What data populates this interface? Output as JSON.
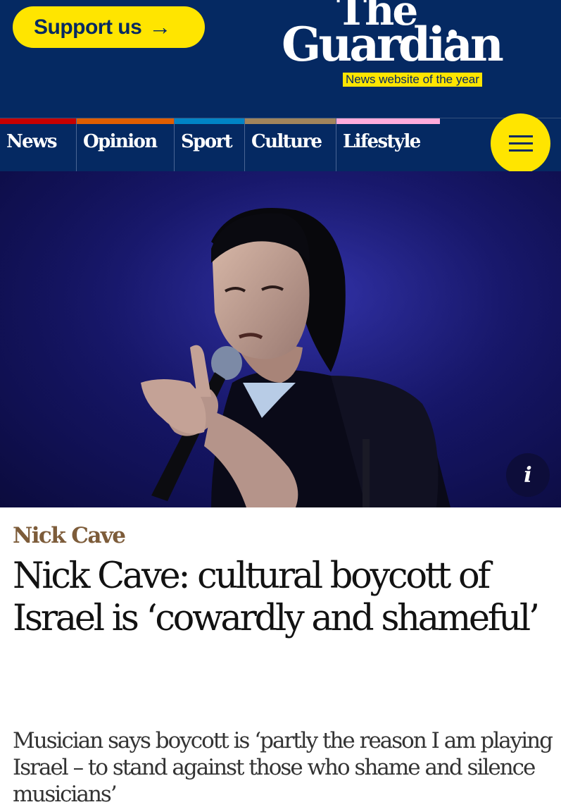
{
  "masthead": {
    "support_label": "Support us",
    "support_arrow": "→",
    "logo_line1": "The",
    "logo_line2": "Guardian",
    "tagline": "News website of the year"
  },
  "nav": {
    "items": [
      {
        "label": "News",
        "color": "#c70000"
      },
      {
        "label": "Opinion",
        "color": "#e05e00"
      },
      {
        "label": "Sport",
        "color": "#0084c6"
      },
      {
        "label": "Culture",
        "color": "#a1845c"
      },
      {
        "label": "Lifestyle",
        "color": "#ffabdb"
      }
    ],
    "menu_icon": "hamburger-menu-icon"
  },
  "hero": {
    "image_subject": "photo",
    "info_label": "i"
  },
  "article": {
    "kicker": "Nick Cave",
    "headline": "Nick Cave: cultural boycott of Israel is ‘cowardly and shameful’",
    "standfirst": "Musician says boycott is ‘partly the reason I am playing Israel – to stand against those who shame and silence musicians’"
  },
  "colors": {
    "brand_blue": "#052962",
    "brand_yellow": "#ffe500",
    "culture_kicker": "#7d5c3a"
  }
}
